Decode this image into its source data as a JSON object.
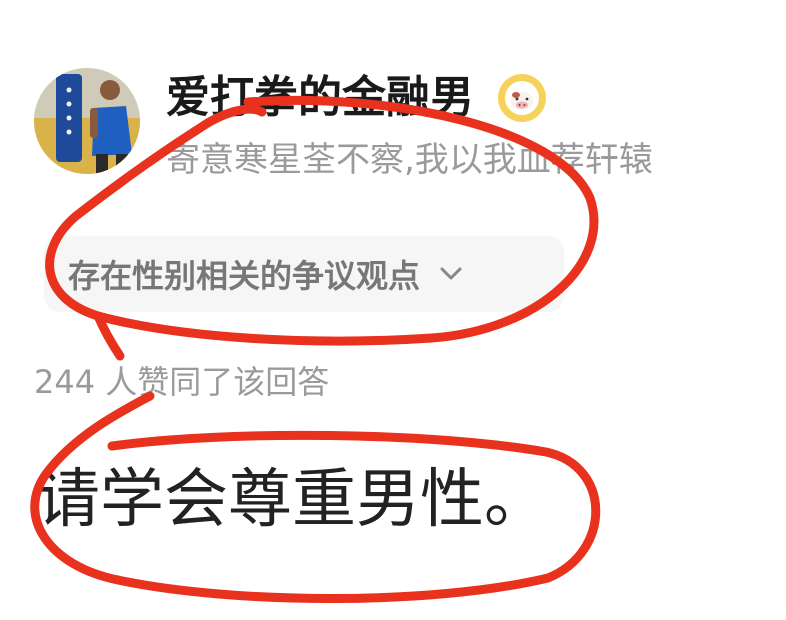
{
  "answer_card": {
    "author": {
      "avatar_icon": "boxer-avatar-photo",
      "name": "爱打拳的金融男",
      "badge_icon": "cow-badge-icon",
      "bio": "寄意寒星荃不察,我以我血荐轩辕"
    },
    "notice": {
      "label": "存在性别相关的争议观点",
      "chevron_icon": "chevron-down-icon"
    },
    "likes": {
      "text": "244 人赞同了该回答"
    },
    "answer": {
      "text": "请学会尊重男性。"
    }
  },
  "annotations": {
    "stroke_color": "#e8321e",
    "shape": "hand-drawn-ellipse"
  }
}
